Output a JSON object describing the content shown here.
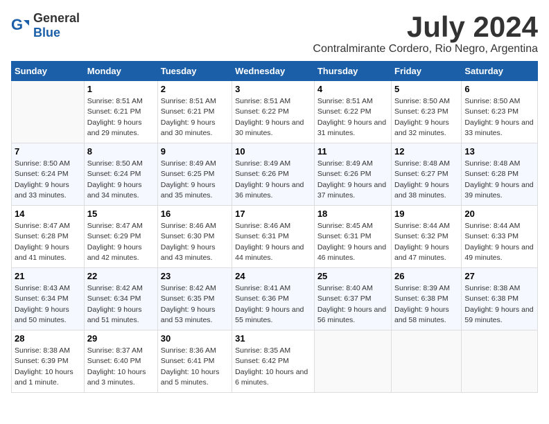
{
  "logo": {
    "general": "General",
    "blue": "Blue"
  },
  "title": "July 2024",
  "subtitle": "Contralmirante Cordero, Rio Negro, Argentina",
  "weekdays": [
    "Sunday",
    "Monday",
    "Tuesday",
    "Wednesday",
    "Thursday",
    "Friday",
    "Saturday"
  ],
  "weeks": [
    [
      {
        "day": "",
        "sunrise": "",
        "sunset": "",
        "daylight": ""
      },
      {
        "day": "1",
        "sunrise": "Sunrise: 8:51 AM",
        "sunset": "Sunset: 6:21 PM",
        "daylight": "Daylight: 9 hours and 29 minutes."
      },
      {
        "day": "2",
        "sunrise": "Sunrise: 8:51 AM",
        "sunset": "Sunset: 6:21 PM",
        "daylight": "Daylight: 9 hours and 30 minutes."
      },
      {
        "day": "3",
        "sunrise": "Sunrise: 8:51 AM",
        "sunset": "Sunset: 6:22 PM",
        "daylight": "Daylight: 9 hours and 30 minutes."
      },
      {
        "day": "4",
        "sunrise": "Sunrise: 8:51 AM",
        "sunset": "Sunset: 6:22 PM",
        "daylight": "Daylight: 9 hours and 31 minutes."
      },
      {
        "day": "5",
        "sunrise": "Sunrise: 8:50 AM",
        "sunset": "Sunset: 6:23 PM",
        "daylight": "Daylight: 9 hours and 32 minutes."
      },
      {
        "day": "6",
        "sunrise": "Sunrise: 8:50 AM",
        "sunset": "Sunset: 6:23 PM",
        "daylight": "Daylight: 9 hours and 33 minutes."
      }
    ],
    [
      {
        "day": "7",
        "sunrise": "Sunrise: 8:50 AM",
        "sunset": "Sunset: 6:24 PM",
        "daylight": "Daylight: 9 hours and 33 minutes."
      },
      {
        "day": "8",
        "sunrise": "Sunrise: 8:50 AM",
        "sunset": "Sunset: 6:24 PM",
        "daylight": "Daylight: 9 hours and 34 minutes."
      },
      {
        "day": "9",
        "sunrise": "Sunrise: 8:49 AM",
        "sunset": "Sunset: 6:25 PM",
        "daylight": "Daylight: 9 hours and 35 minutes."
      },
      {
        "day": "10",
        "sunrise": "Sunrise: 8:49 AM",
        "sunset": "Sunset: 6:26 PM",
        "daylight": "Daylight: 9 hours and 36 minutes."
      },
      {
        "day": "11",
        "sunrise": "Sunrise: 8:49 AM",
        "sunset": "Sunset: 6:26 PM",
        "daylight": "Daylight: 9 hours and 37 minutes."
      },
      {
        "day": "12",
        "sunrise": "Sunrise: 8:48 AM",
        "sunset": "Sunset: 6:27 PM",
        "daylight": "Daylight: 9 hours and 38 minutes."
      },
      {
        "day": "13",
        "sunrise": "Sunrise: 8:48 AM",
        "sunset": "Sunset: 6:28 PM",
        "daylight": "Daylight: 9 hours and 39 minutes."
      }
    ],
    [
      {
        "day": "14",
        "sunrise": "Sunrise: 8:47 AM",
        "sunset": "Sunset: 6:28 PM",
        "daylight": "Daylight: 9 hours and 41 minutes."
      },
      {
        "day": "15",
        "sunrise": "Sunrise: 8:47 AM",
        "sunset": "Sunset: 6:29 PM",
        "daylight": "Daylight: 9 hours and 42 minutes."
      },
      {
        "day": "16",
        "sunrise": "Sunrise: 8:46 AM",
        "sunset": "Sunset: 6:30 PM",
        "daylight": "Daylight: 9 hours and 43 minutes."
      },
      {
        "day": "17",
        "sunrise": "Sunrise: 8:46 AM",
        "sunset": "Sunset: 6:31 PM",
        "daylight": "Daylight: 9 hours and 44 minutes."
      },
      {
        "day": "18",
        "sunrise": "Sunrise: 8:45 AM",
        "sunset": "Sunset: 6:31 PM",
        "daylight": "Daylight: 9 hours and 46 minutes."
      },
      {
        "day": "19",
        "sunrise": "Sunrise: 8:44 AM",
        "sunset": "Sunset: 6:32 PM",
        "daylight": "Daylight: 9 hours and 47 minutes."
      },
      {
        "day": "20",
        "sunrise": "Sunrise: 8:44 AM",
        "sunset": "Sunset: 6:33 PM",
        "daylight": "Daylight: 9 hours and 49 minutes."
      }
    ],
    [
      {
        "day": "21",
        "sunrise": "Sunrise: 8:43 AM",
        "sunset": "Sunset: 6:34 PM",
        "daylight": "Daylight: 9 hours and 50 minutes."
      },
      {
        "day": "22",
        "sunrise": "Sunrise: 8:42 AM",
        "sunset": "Sunset: 6:34 PM",
        "daylight": "Daylight: 9 hours and 51 minutes."
      },
      {
        "day": "23",
        "sunrise": "Sunrise: 8:42 AM",
        "sunset": "Sunset: 6:35 PM",
        "daylight": "Daylight: 9 hours and 53 minutes."
      },
      {
        "day": "24",
        "sunrise": "Sunrise: 8:41 AM",
        "sunset": "Sunset: 6:36 PM",
        "daylight": "Daylight: 9 hours and 55 minutes."
      },
      {
        "day": "25",
        "sunrise": "Sunrise: 8:40 AM",
        "sunset": "Sunset: 6:37 PM",
        "daylight": "Daylight: 9 hours and 56 minutes."
      },
      {
        "day": "26",
        "sunrise": "Sunrise: 8:39 AM",
        "sunset": "Sunset: 6:38 PM",
        "daylight": "Daylight: 9 hours and 58 minutes."
      },
      {
        "day": "27",
        "sunrise": "Sunrise: 8:38 AM",
        "sunset": "Sunset: 6:38 PM",
        "daylight": "Daylight: 9 hours and 59 minutes."
      }
    ],
    [
      {
        "day": "28",
        "sunrise": "Sunrise: 8:38 AM",
        "sunset": "Sunset: 6:39 PM",
        "daylight": "Daylight: 10 hours and 1 minute."
      },
      {
        "day": "29",
        "sunrise": "Sunrise: 8:37 AM",
        "sunset": "Sunset: 6:40 PM",
        "daylight": "Daylight: 10 hours and 3 minutes."
      },
      {
        "day": "30",
        "sunrise": "Sunrise: 8:36 AM",
        "sunset": "Sunset: 6:41 PM",
        "daylight": "Daylight: 10 hours and 5 minutes."
      },
      {
        "day": "31",
        "sunrise": "Sunrise: 8:35 AM",
        "sunset": "Sunset: 6:42 PM",
        "daylight": "Daylight: 10 hours and 6 minutes."
      },
      {
        "day": "",
        "sunrise": "",
        "sunset": "",
        "daylight": ""
      },
      {
        "day": "",
        "sunrise": "",
        "sunset": "",
        "daylight": ""
      },
      {
        "day": "",
        "sunrise": "",
        "sunset": "",
        "daylight": ""
      }
    ]
  ]
}
